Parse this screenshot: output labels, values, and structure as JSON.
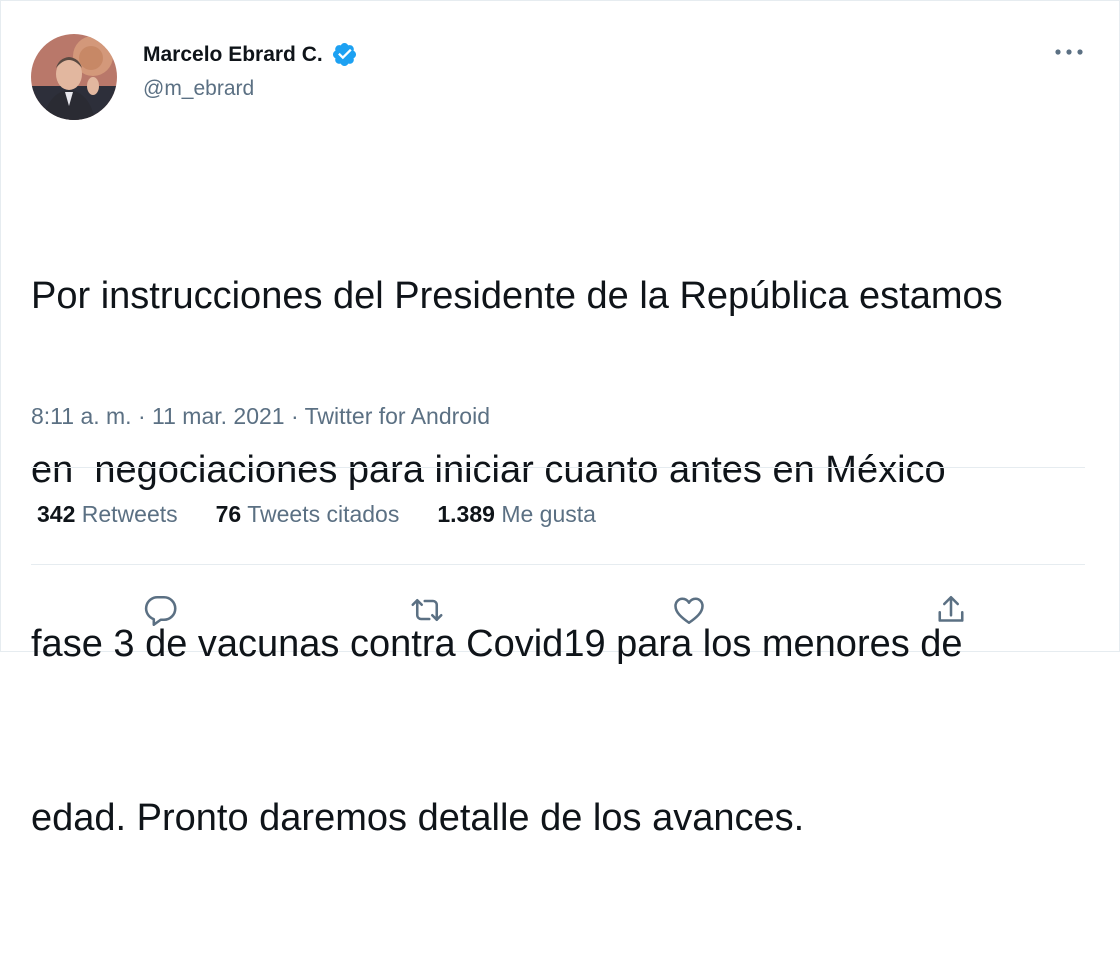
{
  "author": {
    "name": "Marcelo Ebrard C.",
    "handle": "@m_ebrard",
    "verified": true
  },
  "tweet": {
    "lines": [
      "Por instrucciones del Presidente de la República estamos",
      "en  negociaciones para iniciar cuanto antes en México",
      "fase 3 de vacunas contra Covid19 para los menores de",
      "edad. Pronto daremos detalle de los avances."
    ]
  },
  "meta": {
    "time": "8:11 a. m.",
    "date": "11 mar. 2021",
    "source": "Twitter for Android",
    "separator": " · "
  },
  "stats": {
    "retweets": {
      "count": "342",
      "label": "Retweets"
    },
    "quotes": {
      "count": "76",
      "label": "Tweets citados"
    },
    "likes": {
      "count": "1.389",
      "label": "Me gusta"
    }
  },
  "icons": {
    "more": "more-horizontal-icon",
    "reply": "reply-icon",
    "retweet": "retweet-icon",
    "like": "heart-icon",
    "share": "share-icon",
    "verified": "verified-badge-icon"
  },
  "colors": {
    "text": "#0f1419",
    "secondary": "#5b7083",
    "verified": "#1da1f2",
    "border": "#e6ecf0"
  }
}
